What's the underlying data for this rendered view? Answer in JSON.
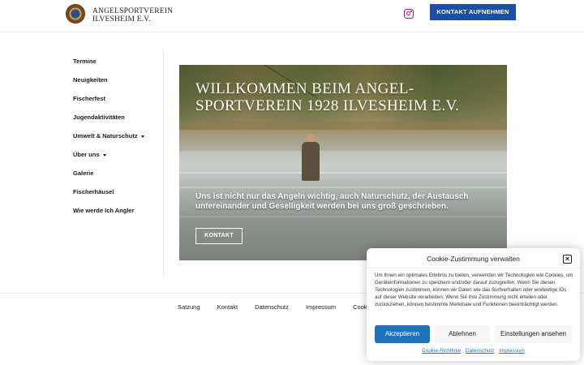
{
  "header": {
    "brand_line1": "ANGELSPORTVEREIN",
    "brand_line2": "ILVESHEIM E.V.",
    "contact_button": "KONTAKT AUFNEHMEN",
    "social_icon": "instagram-icon",
    "accent_color": "#1a4fa3"
  },
  "sidebar": {
    "items": [
      {
        "label": "Termine"
      },
      {
        "label": "Neuigkeiten"
      },
      {
        "label": "Fischerfest"
      },
      {
        "label": "Jugendaktivitäten"
      },
      {
        "label": "Umwelt & Naturschutz",
        "has_dropdown": true
      },
      {
        "label": "Über uns",
        "has_dropdown": true
      },
      {
        "label": "Galerie"
      },
      {
        "label": "Fischerhäusel"
      },
      {
        "label": "Wie werde Ich Angler"
      }
    ]
  },
  "hero": {
    "title": "WILLKOMMEN BEIM ANGEL-SPORTVEREIN 1928 ILVESHEIM E.V.",
    "subtitle": "Uns ist nicht nur das Angeln wichtig, auch Naturschutz, der Austausch untereinander und Geselligkeit werden bei uns groß geschrieben.",
    "button": "KONTAKT"
  },
  "footer": {
    "links": [
      "Satzung",
      "Kontakt",
      "Datenschutz",
      "Impressum",
      "Cookie"
    ]
  },
  "cookie": {
    "title": "Cookie-Zustimmung verwalten",
    "text": "Um Ihnen ein optimales Erlebnis zu bieten, verwenden wir Technologien wie Cookies, um Geräteinformationen zu speichern und/oder darauf zuzugreifen. Wenn Sie diesen Technologien zustimmen, können wir Daten wie das Surfverhalten oder eindeutige IDs auf dieser Website verarbeiten. Wenn Sie Ihre Zustimmung nicht erteilen oder zurückziehen, können bestimmte Merkmale und Funktionen beeinträchtigt werden.",
    "accept": "Akzeptieren",
    "deny": "Ablehnen",
    "settings": "Einstellungen ansehen",
    "links": [
      "Cookie-Richtlinie",
      "Datenschutz",
      "Impressum"
    ],
    "accept_color": "#1e73be"
  }
}
